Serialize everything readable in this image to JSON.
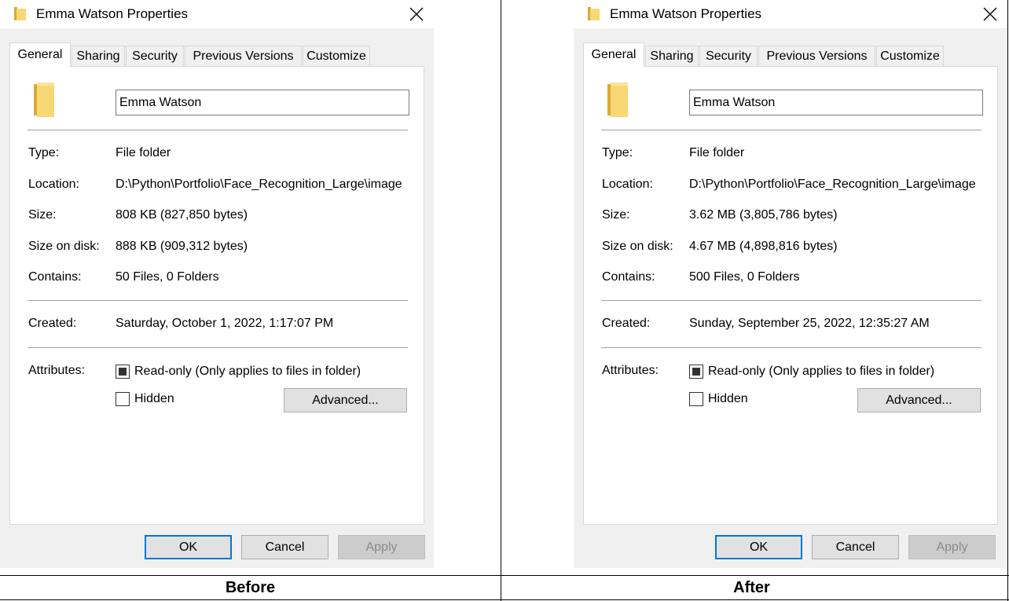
{
  "panels": [
    {
      "caption": "Before",
      "dialog": {
        "title": "Emma Watson Properties",
        "close_glyph": "✕",
        "tabs": [
          "General",
          "Sharing",
          "Security",
          "Previous Versions",
          "Customize"
        ],
        "folder_name": "Emma Watson",
        "type_label": "Type:",
        "type_value": "File folder",
        "location_label": "Location:",
        "location_value": "D:\\Python\\Portfolio\\Face_Recognition_Large\\image",
        "size_label": "Size:",
        "size_value": "808 KB (827,850 bytes)",
        "disk_label": "Size on disk:",
        "disk_value": "888 KB (909,312 bytes)",
        "contains_label": "Contains:",
        "contains_value": "50 Files, 0 Folders",
        "created_label": "Created:",
        "created_value": "Saturday, October 1, 2022, 1:17:07 PM",
        "attributes_label": "Attributes:",
        "readonly_label": "Read-only (Only applies to files in folder)",
        "hidden_label": "Hidden",
        "advanced_label": "Advanced...",
        "ok_label": "OK",
        "cancel_label": "Cancel",
        "apply_label": "Apply"
      }
    },
    {
      "caption": "After",
      "dialog": {
        "title": "Emma Watson Properties",
        "close_glyph": "✕",
        "tabs": [
          "General",
          "Sharing",
          "Security",
          "Previous Versions",
          "Customize"
        ],
        "folder_name": "Emma Watson",
        "type_label": "Type:",
        "type_value": "File folder",
        "location_label": "Location:",
        "location_value": "D:\\Python\\Portfolio\\Face_Recognition_Large\\image",
        "size_label": "Size:",
        "size_value": "3.62 MB (3,805,786 bytes)",
        "disk_label": "Size on disk:",
        "disk_value": "4.67 MB (4,898,816 bytes)",
        "contains_label": "Contains:",
        "contains_value": "500 Files, 0 Folders",
        "created_label": "Created:",
        "created_value": "Sunday, September 25, 2022, 12:35:27 AM",
        "attributes_label": "Attributes:",
        "readonly_label": "Read-only (Only applies to files in folder)",
        "hidden_label": "Hidden",
        "advanced_label": "Advanced...",
        "ok_label": "OK",
        "cancel_label": "Cancel",
        "apply_label": "Apply"
      }
    }
  ],
  "icons": {
    "folder": "folder-icon",
    "close": "close-icon"
  },
  "colors": {
    "dialog_bg": "#f0f0f0",
    "accent": "#0078d7",
    "folder": "#f8d775"
  }
}
